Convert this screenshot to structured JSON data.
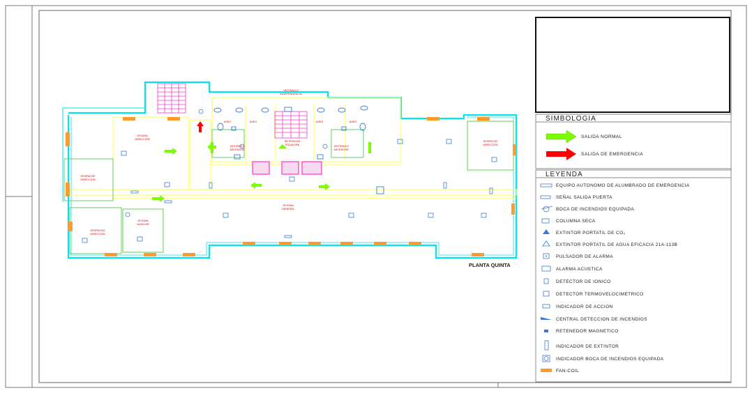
{
  "plan": {
    "title": "PLANTA QUINTA",
    "room_labels": {
      "office_left": "OFICINA\nDIRECCION",
      "office_left_sub": "",
      "corridor": "OFICINA\nGENERAL",
      "office_lower_left": "OFICINA\nAUXILIAR",
      "office_lower_mid": "OFICINA\nAUXILIAR",
      "dispatch_right": "DESPACHO\nDIRECCION",
      "dispatch_left": "DESPACHO\nDIRECCION",
      "retention": "RETENCION\nESCALERA",
      "top_stair": "VESTIBULO\nINDEPENDENCIA",
      "core_left": "VESTIBULO\nASCENSOR",
      "core_right": "VESTIBULO\nASCENSOR"
    }
  },
  "simbologia": {
    "header": "SIMBOLOGIA",
    "items": [
      {
        "label": "SALIDA NORMAL",
        "color": "#7CFC00",
        "icon": "green-arrow-icon"
      },
      {
        "label": "SALIDA DE EMERGENCIA",
        "color": "#FF0000",
        "icon": "red-arrow-icon"
      }
    ]
  },
  "leyenda": {
    "header": "LEYENDA",
    "items": [
      {
        "label": "EQUIPO AUTONOMO DE ALUMBRADO DE EMERGENCIA",
        "icon": "emergency-light-icon"
      },
      {
        "label": "SEÑAL SALIDA PUERTA",
        "icon": "exit-sign-icon"
      },
      {
        "label": "BOCA DE INCENDIOS EQUIPADA",
        "icon": "fire-hose-icon"
      },
      {
        "label": "COLUMNA SECA",
        "icon": "dry-column-icon"
      },
      {
        "label": "EXTINTOR PORTATIL DE CO₂",
        "icon": "co2-extinguisher-icon"
      },
      {
        "label": "EXTINTOR PORTATIL DE AGUA EFICACIA 21A-113B",
        "icon": "water-extinguisher-icon"
      },
      {
        "label": "PULSADOR DE ALARMA",
        "icon": "alarm-button-icon"
      },
      {
        "label": "ALARMA ACUSTICA",
        "icon": "siren-icon"
      },
      {
        "label": "DETECTOR DE IONICO",
        "icon": "ionic-detector-icon"
      },
      {
        "label": "DETECTOR TERMOVELOCIMETRICO",
        "icon": "heat-detector-icon"
      },
      {
        "label": "INDICADOR DE ACCION",
        "icon": "action-indicator-icon"
      },
      {
        "label": "CENTRAL DETECCION DE INCENDIOS",
        "icon": "fire-panel-icon"
      },
      {
        "label": "RETENEDOR MAGNETICO",
        "icon": "magnetic-holder-icon"
      },
      {
        "label": "INDICADOR DE EXTINTOR",
        "icon": "extinguisher-sign-icon"
      },
      {
        "label": "INDICADOR BOCA DE INCENDIOS EQUIPADA",
        "icon": "hose-sign-icon"
      },
      {
        "label": "FAN-COIL",
        "icon": "fan-coil-icon"
      }
    ]
  },
  "colors": {
    "wall": "#00E5EE",
    "wall_inner": "#FFFF66",
    "room_text": "#D40000",
    "stair": "#FF33CC",
    "green": "#7CFC00",
    "fancoil": "#FF9A2E",
    "symbol": "#3A7BD5",
    "frame": "#555555",
    "legend_text": "#1a1a8a"
  }
}
